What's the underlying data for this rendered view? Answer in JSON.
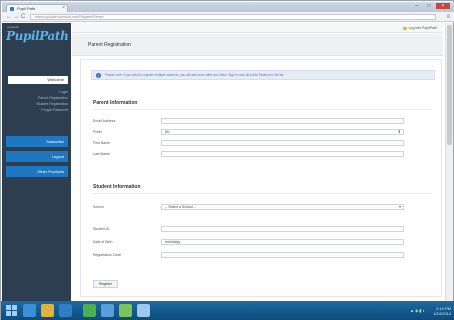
{
  "browser": {
    "tab_title": "Pupil Path",
    "close_glyph": "×",
    "window_buttons": [
      "–",
      "□",
      "×"
    ],
    "nav": {
      "back": "←",
      "forward": "→",
      "reload": "C"
    },
    "url": "www.pupilpath.skedula.com/Register/Parent",
    "menu_glyph": "≡"
  },
  "sidebar": {
    "logo": "PupilPath",
    "logo_tm": "...",
    "logo_caption": "pupilpath",
    "active_item": "Welcome",
    "links": [
      "Login",
      "Parent Registration",
      "Student Registration",
      "Forgot Password"
    ],
    "buttons": [
      "Subscribe",
      "Logout",
      "Other Products"
    ]
  },
  "header": {
    "login_link": "Log into PupilPath",
    "page_title": "Parent Registration"
  },
  "alert": {
    "icon": "i",
    "text": "Please note: if you wish to register multiple students, you will add more after you finish. Sign in and click Add Student to the list."
  },
  "parent_info": {
    "title": "Parent Information",
    "fields": [
      {
        "label": "Email Address",
        "value": ""
      },
      {
        "label": "Prefix",
        "value": "Mr.",
        "caret": "⬍"
      },
      {
        "label": "First Name",
        "value": ""
      },
      {
        "label": "Last Name",
        "value": ""
      }
    ]
  },
  "student_info": {
    "title": "Student Information",
    "fields": [
      {
        "label": "School",
        "value": "-- Select a School --",
        "caret": "▾"
      },
      {
        "label": "Student ID",
        "value": ""
      },
      {
        "label": "Date of Birth",
        "value": "mm/dd/yy"
      },
      {
        "label": "Registration Code",
        "value": ""
      }
    ]
  },
  "submit_label": "Register",
  "taskbar": {
    "time": "2:14 PM",
    "date": "1/24/2014",
    "tray": "▲ ◈ ▮ ◐"
  },
  "colors": {
    "sidebar_bg": "#2d3e50",
    "sidebar_button": "#1d78c1",
    "logo": "#5bb3ea",
    "alert_bg": "#e6ecf8",
    "taskbar": "#0e4a78"
  }
}
